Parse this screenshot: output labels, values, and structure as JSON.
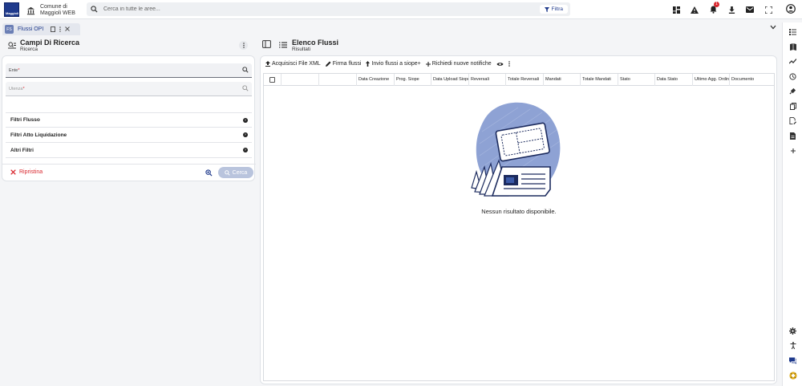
{
  "app": {
    "logo_text": "Maggioli",
    "municipality_line1": "Comune di",
    "municipality_line2": "Maggioli WEB",
    "search_placeholder": "Cerca in tutte le aree...",
    "filter_label": "Filtra",
    "notification_count": "1",
    "icons": [
      "dashboard-icon",
      "warning-icon",
      "bell-icon",
      "download-icon",
      "mail-icon",
      "fullscreen-icon",
      "user-icon"
    ]
  },
  "tab": {
    "icon_text": "FS",
    "label": "Flussi OPI"
  },
  "left": {
    "title": "Campi Di Ricerca",
    "subtitle": "Ricerca",
    "fields": [
      {
        "label": "Ente",
        "required": "*"
      },
      {
        "label": "Utenza",
        "required": "*"
      }
    ],
    "accordions": [
      "Filtri Flusso",
      "Filtri Atto Liquidazione",
      "Altri Filtri"
    ],
    "reset_label": "Ripristina",
    "search_label": "Cerca"
  },
  "right": {
    "title": "Elenco Flussi",
    "subtitle": "Risultati",
    "toolbar": [
      {
        "icon": "upload-icon",
        "label": "Acquisisci File XML"
      },
      {
        "icon": "pen-icon",
        "label": "Firma flussi"
      },
      {
        "icon": "send-icon",
        "label": "Invio flussi a siope+"
      },
      {
        "icon": "plus-icon",
        "label": "Richiedi nuove notifiche"
      }
    ],
    "columns": [
      "",
      "",
      "",
      "Data Creazione",
      "Prog. Siope",
      "Data Upload Siope",
      "Reversali",
      "Totale Reversali",
      "Mandati",
      "Totale Mandati",
      "Stato",
      "Data Stato",
      "Ultimo Agg. Ordinativi",
      "Documento"
    ],
    "empty_message": "Nessun risultato disponibile."
  },
  "colors": {
    "brand": "#1f3a8c",
    "danger": "#d9272e",
    "illustration_blob": "#8ea2d4"
  }
}
